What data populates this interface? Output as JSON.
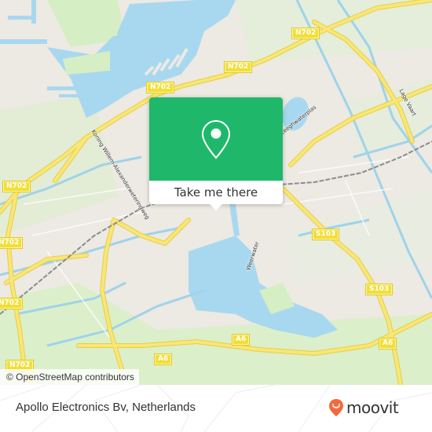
{
  "map": {
    "colors": {
      "land": "#ede9e3",
      "water": "#a8d8ef",
      "park": "#d6eec4",
      "road_major": "#f6e26b",
      "road_casing": "#e8cf3c",
      "rail": "#8c8c8c",
      "canal": "#9fd3ea"
    },
    "road_shields": [
      {
        "label": "N702",
        "pos": "top-center-right"
      },
      {
        "label": "N702",
        "pos": "upper-center"
      },
      {
        "label": "N702",
        "pos": "upper-left"
      },
      {
        "label": "N702",
        "pos": "left-middle"
      },
      {
        "label": "N702",
        "pos": "left-lower"
      },
      {
        "label": "N702",
        "pos": "bottom-left"
      },
      {
        "label": "S103",
        "pos": "right-middle"
      },
      {
        "label": "S103",
        "pos": "right-lower"
      },
      {
        "label": "A6",
        "pos": "bottom-center-left"
      },
      {
        "label": "A6",
        "pos": "bottom-center"
      },
      {
        "label": "A6",
        "pos": "bottom-right"
      }
    ],
    "street_labels": [
      "Koning Willem-Alexanderweteringweg",
      "Leeghwaterplas",
      "Lage Vaart",
      "Weerwater"
    ],
    "attribution": "© OpenStreetMap contributors"
  },
  "popup": {
    "icon": "map-pin-icon",
    "cta_label": "Take me there",
    "accent": "#1fb86a"
  },
  "footer": {
    "place_name": "Apollo Electronics Bv, Netherlands",
    "logo_text": "moovit",
    "logo_color": "#f26a3d"
  }
}
